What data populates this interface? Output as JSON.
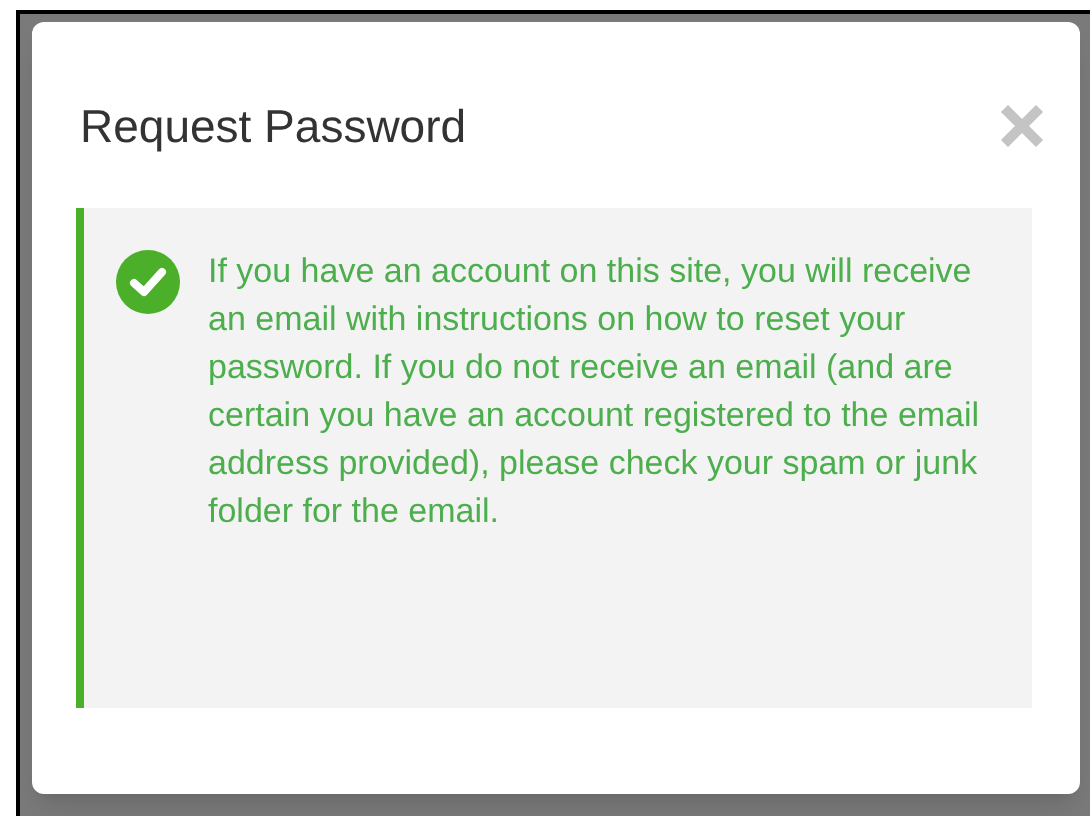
{
  "dialog": {
    "title": "Request Password",
    "alert": {
      "kind": "success",
      "message": "If you have an account on this site, you will receive an email with instructions on how to reset your password. If you do not receive an email (and are certain you have an account registered to the email address provided), please check your spam or junk folder for the email."
    }
  }
}
